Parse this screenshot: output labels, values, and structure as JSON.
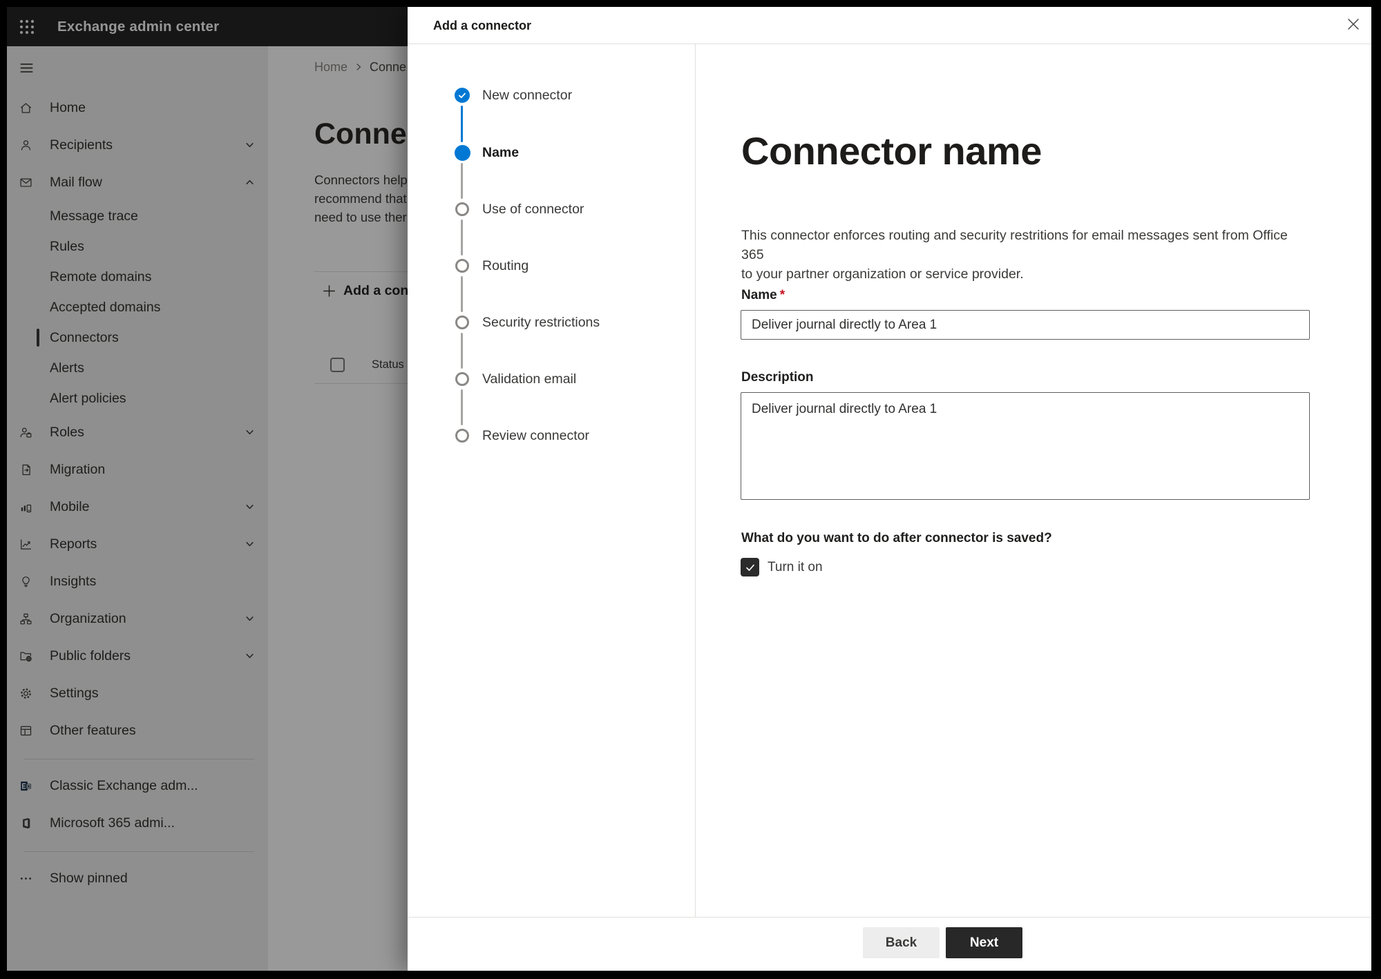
{
  "colors": {
    "accent_blue": "#0078d4",
    "required_red": "#c50f1f",
    "next_button_bg": "#282828",
    "back_button_bg": "#ededed",
    "topbar_bg": "#252525",
    "sidebar_bg": "#eeeeee",
    "overlay": "rgba(0,0,0,0.40)"
  },
  "topbar": {
    "title": "Exchange admin center",
    "app_launcher_icon": "waffle-icon"
  },
  "sidebar": {
    "menu_icon": "hamburger-icon",
    "items": [
      {
        "label": "Home",
        "icon": "home-icon"
      },
      {
        "label": "Recipients",
        "icon": "person-icon",
        "chevron": "down"
      },
      {
        "label": "Mail flow",
        "icon": "mail-icon",
        "chevron": "up"
      },
      {
        "label": "Message trace",
        "sub": true
      },
      {
        "label": "Rules",
        "sub": true
      },
      {
        "label": "Remote domains",
        "sub": true
      },
      {
        "label": "Accepted domains",
        "sub": true
      },
      {
        "label": "Connectors",
        "sub": true,
        "selected": true
      },
      {
        "label": "Alerts",
        "sub": true
      },
      {
        "label": "Alert policies",
        "sub": true
      },
      {
        "label": "Roles",
        "icon": "roles-icon",
        "chevron": "down"
      },
      {
        "label": "Migration",
        "icon": "migration-icon"
      },
      {
        "label": "Mobile",
        "icon": "mobile-icon",
        "chevron": "down"
      },
      {
        "label": "Reports",
        "icon": "reports-icon",
        "chevron": "down"
      },
      {
        "label": "Insights",
        "icon": "insights-icon"
      },
      {
        "label": "Organization",
        "icon": "organization-icon",
        "chevron": "down"
      },
      {
        "label": "Public folders",
        "icon": "public-folders-icon",
        "chevron": "down"
      },
      {
        "label": "Settings",
        "icon": "settings-icon"
      },
      {
        "label": "Other features",
        "icon": "other-features-icon"
      }
    ],
    "footer_items": [
      {
        "label": "Classic Exchange adm...",
        "icon": "classic-exchange-icon"
      },
      {
        "label": "Microsoft 365 admi...",
        "icon": "microsoft-365-icon"
      }
    ],
    "show_pinned": {
      "label": "Show pinned",
      "icon": "ellipsis-icon"
    }
  },
  "background_page": {
    "breadcrumb": {
      "items": [
        "Home",
        "Conne"
      ],
      "separator_icon": "chevron-right-icon"
    },
    "page_title": "Connect",
    "intro_lines": [
      "Connectors help",
      "recommend that",
      "need to use ther"
    ],
    "add_button_label": "Add a conn",
    "add_button_icon": "plus-icon",
    "table_header": "Status"
  },
  "modal": {
    "title": "Add a connector",
    "close_icon": "close-icon",
    "steps": [
      {
        "label": "New connector",
        "state": "completed"
      },
      {
        "label": "Name",
        "state": "current"
      },
      {
        "label": "Use of connector",
        "state": "upcoming"
      },
      {
        "label": "Routing",
        "state": "upcoming"
      },
      {
        "label": "Security restrictions",
        "state": "upcoming"
      },
      {
        "label": "Validation email",
        "state": "upcoming"
      },
      {
        "label": "Review connector",
        "state": "upcoming"
      }
    ],
    "content": {
      "heading": "Connector name",
      "description_line1": "This connector enforces routing and security restritions for email messages sent from Office 365",
      "description_line2": "to your partner organization or service provider.",
      "name_label": "Name",
      "required_mark": "*",
      "name_value": "Deliver journal directly to Area 1",
      "description_label": "Description",
      "description_value": "Deliver journal directly to Area 1",
      "after_save_question": "What do you want to do after connector is saved?",
      "turn_it_on_label": "Turn it on",
      "turn_it_on_checked": true
    },
    "footer": {
      "back_label": "Back",
      "next_label": "Next"
    }
  }
}
